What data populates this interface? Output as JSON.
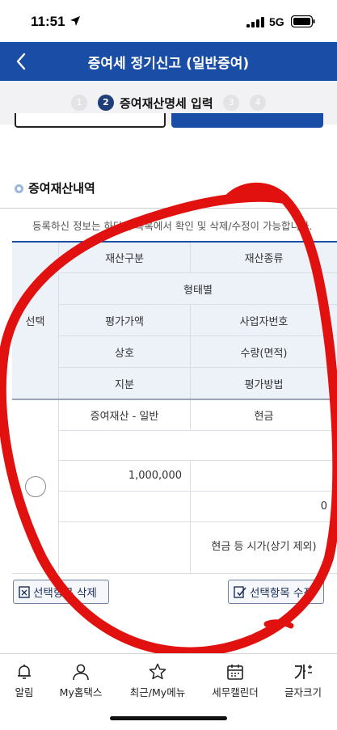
{
  "status": {
    "time": "11:51",
    "network": "5G"
  },
  "header": {
    "title": "증여세 정기신고 (일반증여)"
  },
  "steps": {
    "items": [
      "1",
      "2",
      "3",
      "4"
    ],
    "active_label": "증여재산명세 입력"
  },
  "section": {
    "title": "증여재산내역",
    "notice": "등록하신 정보는 하단의 목록에서 확인 및 삭제/수정이 가능합니다."
  },
  "table": {
    "select_header": "선택",
    "headers": {
      "asset_class": "재산구분",
      "asset_type": "재산종류",
      "form": "형태별",
      "appraised_value": "평가가액",
      "business_no": "사업자번호",
      "trade_name": "상호",
      "quantity": "수량(면적)",
      "share": "지분",
      "appraisal_method": "평가방법"
    },
    "row": {
      "asset_class": "증여재산 - 일반",
      "asset_type": "현금",
      "form": "",
      "appraised_value": "1,000,000",
      "business_no": "",
      "trade_name": "",
      "quantity": "0",
      "share": "",
      "appraisal_method": "현금 등 시가(상기 제외)"
    }
  },
  "actions": {
    "delete_label": "선택항목 삭제",
    "edit_label": "선택항목 수정"
  },
  "bottom_nav": [
    {
      "label": "알림",
      "icon": "bell-icon"
    },
    {
      "label": "My홈택스",
      "icon": "person-icon"
    },
    {
      "label": "최근/My메뉴",
      "icon": "star-icon"
    },
    {
      "label": "세무캘린더",
      "icon": "calendar-icon"
    },
    {
      "label": "글자크기",
      "icon": "font-size-icon"
    }
  ],
  "colors": {
    "brand_blue": "#1a4ea6",
    "annotation_red": "#e0110f"
  }
}
